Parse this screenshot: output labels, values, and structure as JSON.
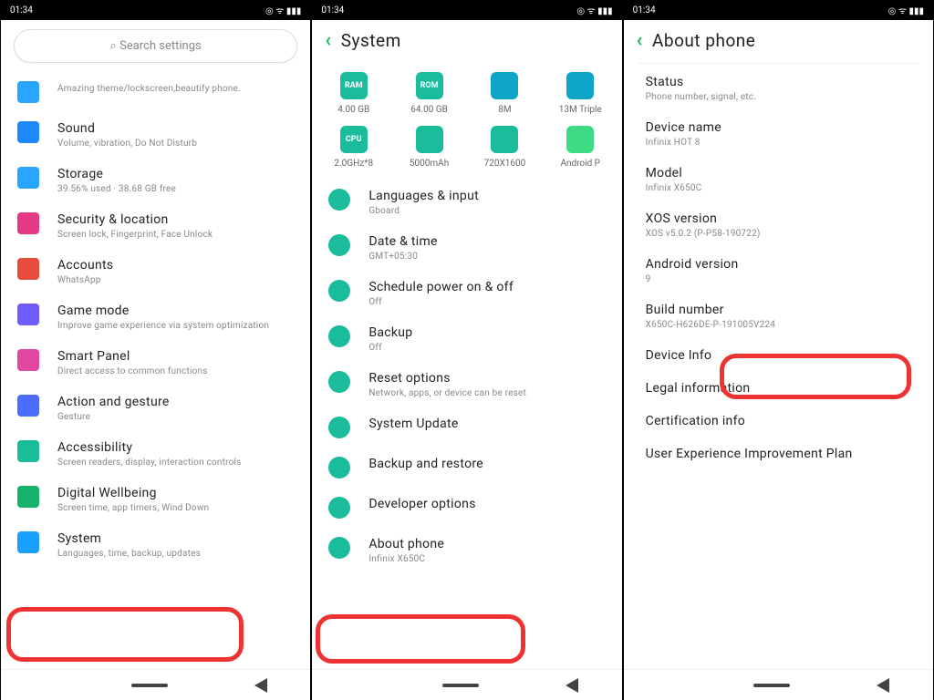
{
  "status": {
    "time": "01:34"
  },
  "p1": {
    "search": "Search settings",
    "items": [
      {
        "title": "",
        "sub": "Amazing theme/lockscreen,beautify phone.",
        "ic": "#2aa6ff"
      },
      {
        "title": "Sound",
        "sub": "Volume, vibration, Do Not Disturb",
        "ic": "#1e88ff"
      },
      {
        "title": "Storage",
        "sub": "39.56% used · 38.68 GB free",
        "ic": "#2aa6ff"
      },
      {
        "title": "Security & location",
        "sub": "Screen lock, Fingerprint, Face Unlock",
        "ic": "#e63985"
      },
      {
        "title": "Accounts",
        "sub": "WhatsApp",
        "ic": "#e74c3c"
      },
      {
        "title": "Game mode",
        "sub": "Improve game experience via system optimization",
        "ic": "#6f5cff"
      },
      {
        "title": "Smart Panel",
        "sub": "Direct access to common functions",
        "ic": "#e146a1"
      },
      {
        "title": "Action and gesture",
        "sub": "Gesture",
        "ic": "#4b6cff"
      },
      {
        "title": "Accessibility",
        "sub": "Screen readers, display, interaction controls",
        "ic": "#1abc9c"
      },
      {
        "title": "Digital Wellbeing",
        "sub": "Screen time, app timers, Wind Down",
        "ic": "#17b36a"
      },
      {
        "title": "System",
        "sub": "Languages, time, backup, updates",
        "ic": "#1aa0ff"
      }
    ]
  },
  "p2": {
    "header": "System",
    "tiles": [
      {
        "label": "4.00 GB",
        "txt": "RAM",
        "bg": "#1abc9c"
      },
      {
        "label": "64.00 GB",
        "txt": "ROM",
        "bg": "#1abc9c"
      },
      {
        "label": "8M",
        "txt": "",
        "bg": "#0ea5c9"
      },
      {
        "label": "13M Triple",
        "txt": "",
        "bg": "#0ea5c9"
      },
      {
        "label": "2.0GHz*8",
        "txt": "CPU",
        "bg": "#1abc9c"
      },
      {
        "label": "5000mAh",
        "txt": "",
        "bg": "#1abc9c"
      },
      {
        "label": "720X1600",
        "txt": "",
        "bg": "#1abc9c"
      },
      {
        "label": "Android P",
        "txt": "",
        "bg": "#3ddc84"
      }
    ],
    "items": [
      {
        "title": "Languages & input",
        "sub": "Gboard",
        "ic": "#1abc9c"
      },
      {
        "title": "Date & time",
        "sub": "GMT+05:30",
        "ic": "#1abc9c"
      },
      {
        "title": "Schedule power on & off",
        "sub": "Off",
        "ic": "#1abc9c"
      },
      {
        "title": "Backup",
        "sub": "Off",
        "ic": "#1abc9c"
      },
      {
        "title": "Reset options",
        "sub": "Network, apps, or device can be reset",
        "ic": "#1abc9c"
      },
      {
        "title": "System Update",
        "sub": "",
        "ic": "#1abc9c"
      },
      {
        "title": "Backup and restore",
        "sub": "",
        "ic": "#1abc9c"
      },
      {
        "title": "Developer options",
        "sub": "",
        "ic": "#1abc9c"
      },
      {
        "title": "About phone",
        "sub": "Infinix X650C",
        "ic": "#1abc9c"
      }
    ]
  },
  "p3": {
    "header": "About phone",
    "items": [
      {
        "title": "Status",
        "sub": "Phone number, signal, etc."
      },
      {
        "title": "Device name",
        "sub": "Infinix HOT 8"
      },
      {
        "title": "Model",
        "sub": "Infinix X650C"
      },
      {
        "title": "XOS version",
        "sub": "XOS v5.0.2 (P-P58-190722)"
      },
      {
        "title": "Android version",
        "sub": "9"
      },
      {
        "title": "Build number",
        "sub": "X650C-H626DE-P-191005V224"
      },
      {
        "title": "Device Info",
        "sub": ""
      },
      {
        "title": "Legal information",
        "sub": ""
      },
      {
        "title": "Certification info",
        "sub": ""
      },
      {
        "title": "User Experience Improvement Plan",
        "sub": ""
      }
    ]
  }
}
